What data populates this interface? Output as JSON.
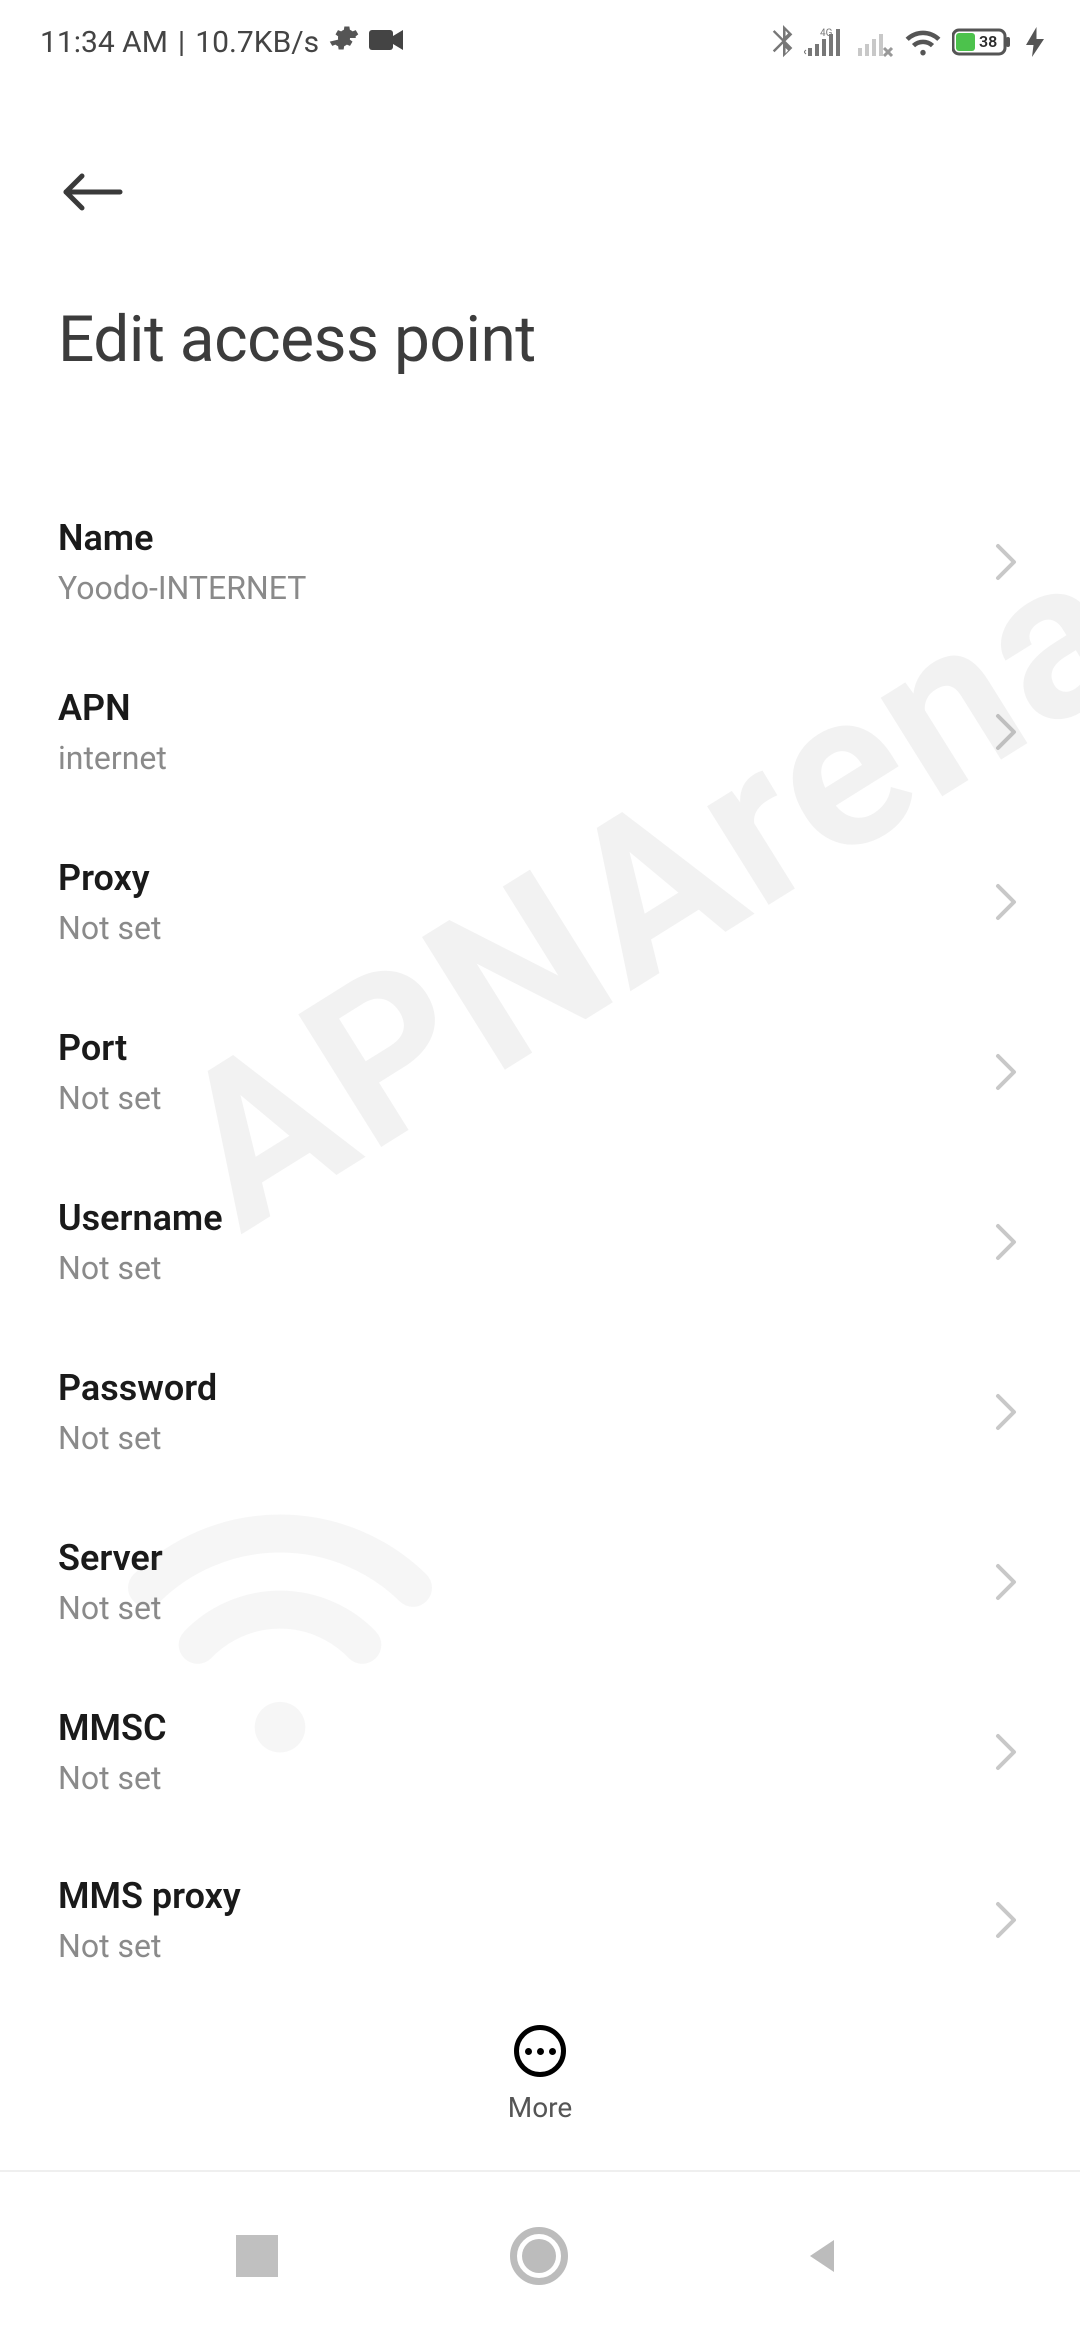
{
  "status": {
    "time": "11:34 AM",
    "divider": "|",
    "rate": "10.7KB/s",
    "battery_percent": "38"
  },
  "page": {
    "title": "Edit access point"
  },
  "rows": [
    {
      "label": "Name",
      "value": "Yoodo-INTERNET"
    },
    {
      "label": "APN",
      "value": "internet"
    },
    {
      "label": "Proxy",
      "value": "Not set"
    },
    {
      "label": "Port",
      "value": "Not set"
    },
    {
      "label": "Username",
      "value": "Not set"
    },
    {
      "label": "Password",
      "value": "Not set"
    },
    {
      "label": "Server",
      "value": "Not set"
    },
    {
      "label": "MMSC",
      "value": "Not set"
    },
    {
      "label": "MMS proxy",
      "value": "Not set"
    }
  ],
  "more_label": "More",
  "watermark": "APNArena"
}
